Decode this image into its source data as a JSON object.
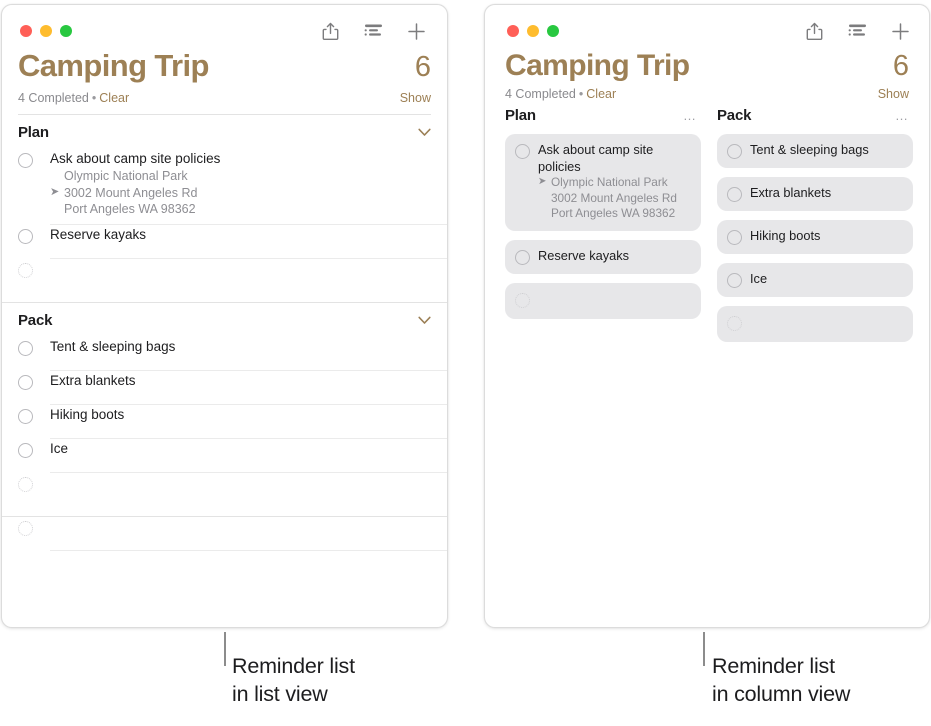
{
  "accent_color": "#9d8055",
  "windows": {
    "list_view": {
      "traffic_lights": [
        "close",
        "minimize",
        "zoom"
      ],
      "toolbar": {
        "share_label": "Share",
        "view_label": "View Options",
        "add_label": "Add Reminder"
      },
      "title": "Camping Trip",
      "count": "6",
      "completed_text": "4 Completed",
      "separator": "•",
      "clear_label": "Clear",
      "show_label": "Show",
      "sections": [
        {
          "name": "Plan",
          "reminders": [
            {
              "title": "Ask about camp site policies",
              "sub_lines": [
                "Olympic National Park",
                "3002 Mount Angeles Rd",
                "Port Angeles WA 98362"
              ],
              "has_location_pin": true
            },
            {
              "title": "Reserve kayaks",
              "sub_lines": [],
              "has_location_pin": false
            },
            {
              "title": "",
              "sub_lines": [],
              "has_location_pin": false,
              "empty": true
            }
          ]
        },
        {
          "name": "Pack",
          "reminders": [
            {
              "title": "Tent & sleeping bags",
              "sub_lines": [],
              "has_location_pin": false
            },
            {
              "title": "Extra blankets",
              "sub_lines": [],
              "has_location_pin": false
            },
            {
              "title": "Hiking boots",
              "sub_lines": [],
              "has_location_pin": false
            },
            {
              "title": "Ice",
              "sub_lines": [],
              "has_location_pin": false
            },
            {
              "title": "",
              "sub_lines": [],
              "has_location_pin": false,
              "empty": true
            }
          ]
        }
      ],
      "trailing_empty_row": {
        "title": "",
        "empty": true
      }
    },
    "column_view": {
      "title": "Camping Trip",
      "count": "6",
      "completed_text": "4 Completed",
      "separator": "•",
      "clear_label": "Clear",
      "show_label": "Show",
      "columns": [
        {
          "name": "Plan",
          "menu_label": "…",
          "cards": [
            {
              "title": "Ask about camp site policies",
              "sub_lines": [
                "Olympic National Park",
                "3002 Mount Angeles Rd",
                "Port Angeles WA 98362"
              ],
              "has_location_pin": true
            },
            {
              "title": "Reserve kayaks",
              "sub_lines": [],
              "has_location_pin": false
            },
            {
              "title": "",
              "sub_lines": [],
              "has_location_pin": false,
              "empty": true
            }
          ]
        },
        {
          "name": "Pack",
          "menu_label": "…",
          "cards": [
            {
              "title": "Tent & sleeping bags",
              "sub_lines": [],
              "has_location_pin": false
            },
            {
              "title": "Extra blankets",
              "sub_lines": [],
              "has_location_pin": false
            },
            {
              "title": "Hiking boots",
              "sub_lines": [],
              "has_location_pin": false
            },
            {
              "title": "Ice",
              "sub_lines": [],
              "has_location_pin": false
            },
            {
              "title": "",
              "sub_lines": [],
              "has_location_pin": false,
              "empty": true
            }
          ]
        }
      ]
    }
  },
  "captions": {
    "list": [
      "Reminder list",
      "in list view"
    ],
    "column": [
      "Reminder list",
      "in column view"
    ]
  }
}
